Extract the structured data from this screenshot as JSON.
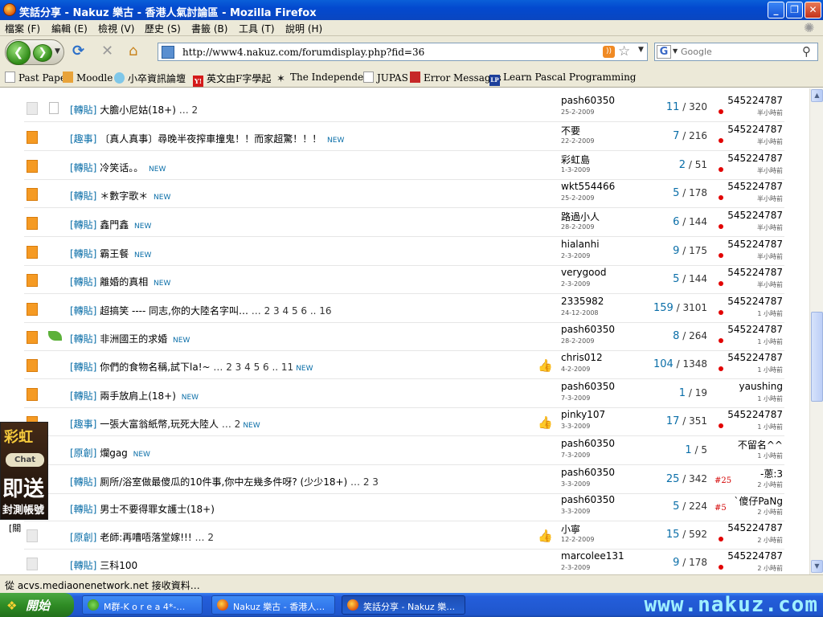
{
  "window": {
    "title": "笑話分享 - Nakuz 樂古 - 香港人氣討論區 - Mozilla Firefox"
  },
  "menu": [
    "檔案 (F)",
    "編輯 (E)",
    "檢視 (V)",
    "歷史 (S)",
    "書籤 (B)",
    "工具 (T)",
    "說明 (H)"
  ],
  "url": "http://www4.nakuz.com/forumdisplay.php?fid=36",
  "search": {
    "placeholder": "Google"
  },
  "bookmarks": [
    "Past Paper",
    "Moodle",
    "小卒資訊論壇",
    "英文由F字學起",
    "The Independent",
    "JUPAS",
    "Error Messages",
    "Learn Pascal Programming"
  ],
  "threads": [
    {
      "tag": "[轉貼]",
      "title": "大膽小尼姑(18+)",
      "pages": "… 2",
      "new": false,
      "author": "pash60350",
      "date": "25-2-2009",
      "replies": "11",
      "views": "320",
      "last_poster": "545224787",
      "last_time": "半小時前",
      "marker": "dot",
      "grey": true,
      "leaf": false,
      "thumb": false
    },
    {
      "tag": "[趣事]",
      "title": "〔真人真事〕尋晚半夜搾車撞鬼！！而家超驚！！！",
      "pages": "",
      "new": true,
      "author": "不要",
      "date": "22-2-2009",
      "replies": "7",
      "views": "216",
      "last_poster": "545224787",
      "last_time": "半小時前",
      "marker": "dot",
      "grey": false,
      "leaf": false,
      "thumb": false
    },
    {
      "tag": "[轉貼]",
      "title": "冷笑话。。",
      "pages": "",
      "new": true,
      "author": "彩虹島",
      "date": "1-3-2009",
      "replies": "2",
      "views": "51",
      "last_poster": "545224787",
      "last_time": "半小時前",
      "marker": "dot",
      "grey": false,
      "leaf": false,
      "thumb": false
    },
    {
      "tag": "[轉貼]",
      "title": "＊數字歌＊",
      "pages": "",
      "new": true,
      "author": "wkt554466",
      "date": "25-2-2009",
      "replies": "5",
      "views": "178",
      "last_poster": "545224787",
      "last_time": "半小時前",
      "marker": "dot",
      "grey": false,
      "leaf": false,
      "thumb": false
    },
    {
      "tag": "[轉貼]",
      "title": "鑫門鑫",
      "pages": "",
      "new": true,
      "author": "路過小人",
      "date": "28-2-2009",
      "replies": "6",
      "views": "144",
      "last_poster": "545224787",
      "last_time": "半小時前",
      "marker": "dot",
      "grey": false,
      "leaf": false,
      "thumb": false
    },
    {
      "tag": "[轉貼]",
      "title": "霸王餐",
      "pages": "",
      "new": true,
      "author": "hialanhi",
      "date": "2-3-2009",
      "replies": "9",
      "views": "175",
      "last_poster": "545224787",
      "last_time": "半小時前",
      "marker": "dot",
      "grey": false,
      "leaf": false,
      "thumb": false
    },
    {
      "tag": "[轉貼]",
      "title": "離婚的真相",
      "pages": "",
      "new": true,
      "author": "verygood",
      "date": "2-3-2009",
      "replies": "5",
      "views": "144",
      "last_poster": "545224787",
      "last_time": "半小時前",
      "marker": "dot",
      "grey": false,
      "leaf": false,
      "thumb": false
    },
    {
      "tag": "[轉貼]",
      "title": "超搞笑 ---- 同志,你的大陸名字叫…",
      "pages": "… 2 3 4 5 6 .. 16",
      "new": false,
      "author": "2335982",
      "date": "24-12-2008",
      "replies": "159",
      "views": "3101",
      "last_poster": "545224787",
      "last_time": "1 小時前",
      "marker": "dot",
      "grey": false,
      "leaf": false,
      "thumb": false
    },
    {
      "tag": "[轉貼]",
      "title": "非洲國王的求婚",
      "pages": "",
      "new": true,
      "author": "pash60350",
      "date": "28-2-2009",
      "replies": "8",
      "views": "264",
      "last_poster": "545224787",
      "last_time": "1 小時前",
      "marker": "dot",
      "grey": false,
      "leaf": true,
      "thumb": false
    },
    {
      "tag": "[轉貼]",
      "title": "你們的食物名稱,試下la!~",
      "pages": "… 2 3 4 5 6 .. 11",
      "new": true,
      "author": "chris012",
      "date": "4-2-2009",
      "replies": "104",
      "views": "1348",
      "last_poster": "545224787",
      "last_time": "1 小時前",
      "marker": "dot",
      "grey": false,
      "leaf": false,
      "thumb": true
    },
    {
      "tag": "[轉貼]",
      "title": "兩手放肩上(18+)",
      "pages": "",
      "new": true,
      "author": "pash60350",
      "date": "7-3-2009",
      "replies": "1",
      "views": "19",
      "last_poster": "yaushing",
      "last_time": "1 小時前",
      "marker": "",
      "grey": false,
      "leaf": false,
      "thumb": false
    },
    {
      "tag": "[趣事]",
      "title": "一張大富翁紙幣,玩死大陸人",
      "pages": "… 2",
      "new": true,
      "author": "pinky107",
      "date": "3-3-2009",
      "replies": "17",
      "views": "351",
      "last_poster": "545224787",
      "last_time": "1 小時前",
      "marker": "dot",
      "grey": false,
      "leaf": false,
      "thumb": true
    },
    {
      "tag": "[原創]",
      "title": "爛gag",
      "pages": "",
      "new": true,
      "author": "pash60350",
      "date": "7-3-2009",
      "replies": "1",
      "views": "5",
      "last_poster": "不留名^^",
      "last_time": "1 小時前",
      "marker": "",
      "grey": false,
      "leaf": false,
      "thumb": false
    },
    {
      "tag": "[轉貼]",
      "title": "厠所/浴室做最傻瓜的10件事,你中左幾多件呀? (少少18+)",
      "pages": "… 2 3",
      "new": false,
      "author": "pash60350",
      "date": "3-3-2009",
      "replies": "25",
      "views": "342",
      "last_poster": "-蔥:3",
      "last_time": "2 小時前",
      "marker": "#25",
      "grey": false,
      "leaf": false,
      "thumb": false
    },
    {
      "tag": "[轉貼]",
      "title": "男士不要得罪女護士(18+)",
      "pages": "",
      "new": false,
      "author": "pash60350",
      "date": "3-3-2009",
      "replies": "5",
      "views": "224",
      "last_poster": "`傻仔PaNg",
      "last_time": "2 小時前",
      "marker": "#5",
      "grey": false,
      "leaf": false,
      "thumb": false
    },
    {
      "tag": "[原創]",
      "title": "老師:再嘈唔落堂嫁!!!",
      "pages": "… 2",
      "new": false,
      "author": "小寧",
      "date": "12-2-2009",
      "replies": "15",
      "views": "592",
      "last_poster": "545224787",
      "last_time": "2 小時前",
      "marker": "dot",
      "grey": true,
      "leaf": false,
      "thumb": true
    },
    {
      "tag": "[轉貼]",
      "title": "三科100",
      "pages": "",
      "new": false,
      "author": "marcolee131",
      "date": "2-3-2009",
      "replies": "9",
      "views": "178",
      "last_poster": "545224787",
      "last_time": "2 小時前",
      "marker": "dot",
      "grey": true,
      "leaf": false,
      "thumb": false
    }
  ],
  "new_label": "NEW",
  "ad": {
    "line1": "彩虹",
    "line2": "Chat",
    "line3": "即送",
    "line4": "封測帳號",
    "label": "[關"
  },
  "status": "從 acvs.mediaonenetwork.net 接收資料…",
  "taskbar": {
    "start": "開始",
    "tasks": [
      "M群-K o r e a 4*-…",
      "Nakuz 樂古 - 香港人…",
      "笑話分享 - Nakuz 樂…"
    ],
    "tray_text": "www.nakuz.com"
  }
}
